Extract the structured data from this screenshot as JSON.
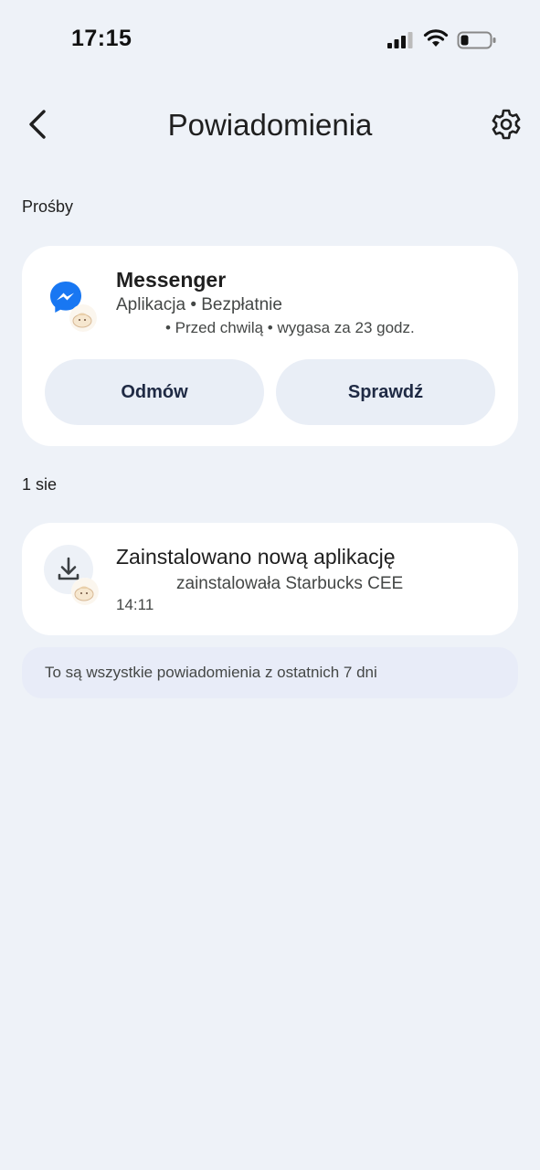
{
  "status_bar": {
    "time": "17:15"
  },
  "header": {
    "title": "Powiadomienia",
    "back_icon": "chevron-left-icon",
    "settings_icon": "gear-icon"
  },
  "requests_section": {
    "label": "Prośby",
    "card": {
      "app_name": "Messenger",
      "subtitle": "Aplikacja • Bezpłatnie",
      "meta": "• Przed chwilą • wygasa za 23 godz.",
      "app_icon": "messenger-icon",
      "decline_label": "Odmów",
      "review_label": "Sprawdź"
    }
  },
  "activity_section": {
    "label": "1 sie",
    "card": {
      "title": "Zainstalowano nową aplikację",
      "subtitle": "zainstalowała Starbucks CEE",
      "time": "14:11",
      "icon": "download-icon"
    }
  },
  "footer_banner": {
    "text": "To są wszystkie powiadomienia z ostatnich 7 dni"
  },
  "colors": {
    "background": "#eef2f8",
    "card": "#ffffff",
    "button": "#e9eef6",
    "messenger_blue": "#1877f2"
  }
}
